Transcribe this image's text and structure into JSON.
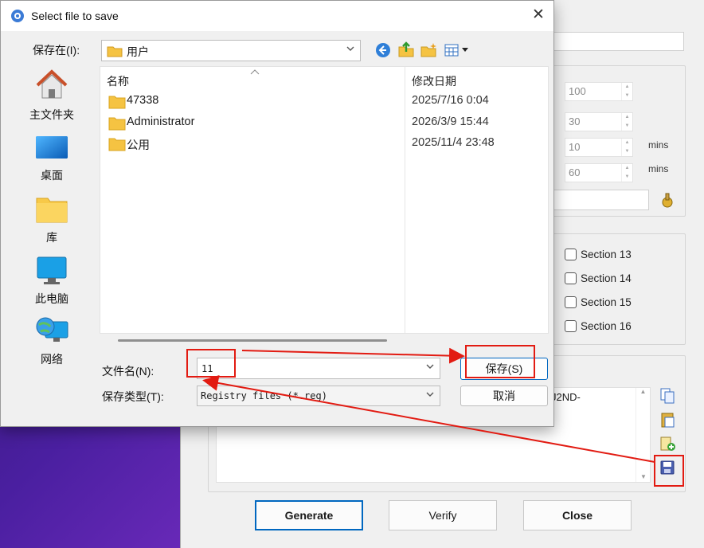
{
  "dialog": {
    "title": "Select file to save",
    "save_in_label": "保存在(I):",
    "save_in_value": "用户",
    "places": [
      {
        "label": "主文件夹",
        "icon": "home-icon"
      },
      {
        "label": "桌面",
        "icon": "desktop-icon"
      },
      {
        "label": "库",
        "icon": "library-folder-icon"
      },
      {
        "label": "此电脑",
        "icon": "monitor-icon"
      },
      {
        "label": "网络",
        "icon": "network-icon"
      }
    ],
    "columns": {
      "name": "名称",
      "modified": "修改日期"
    },
    "files": [
      {
        "name": "47338",
        "date": "2025/7/16 0:04"
      },
      {
        "name": "Administrator",
        "date": "2026/3/9 15:44"
      },
      {
        "name": "公用",
        "date": "2025/11/4 23:48"
      }
    ],
    "filename_label": "文件名(N):",
    "filename_value": "11",
    "filetype_label": "保存类型(T):",
    "filetype_value": "Registry files (*.reg)",
    "save_button": "保存(S)",
    "cancel_button": "取消",
    "toolbar_icons": [
      "back-icon",
      "up-folder-icon",
      "new-folder-icon",
      "view-menu-icon"
    ]
  },
  "app": {
    "spinners": [
      "100",
      "30",
      "10",
      "60"
    ],
    "units": [
      "mins",
      "mins"
    ],
    "sections": [
      "Section 13",
      "Section 14",
      "Section 15",
      "Section 16"
    ],
    "key_text_fragment": "J2ND-",
    "buttons": {
      "generate": "Generate",
      "verify": "Verify",
      "close": "Close"
    }
  },
  "colors": {
    "annotation": "#e21b12",
    "folder": "#f5c342",
    "accent": "#0067c0"
  }
}
